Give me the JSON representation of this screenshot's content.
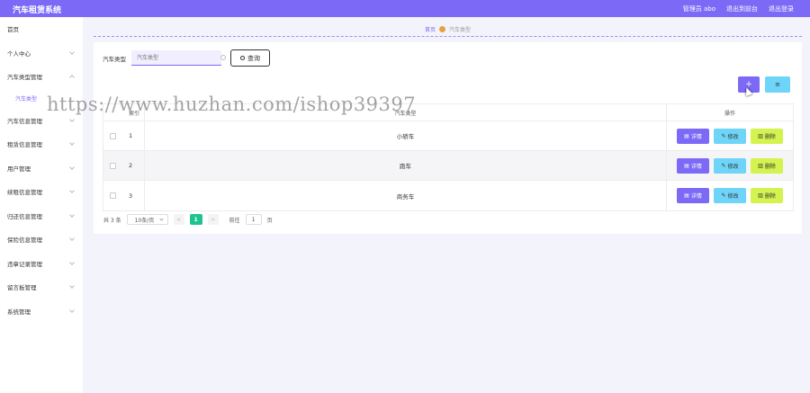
{
  "app": {
    "title": "汽车租赁系统"
  },
  "topbar": {
    "user": "管理员 abo",
    "back_label": "退出到前台",
    "logout_label": "退出登录"
  },
  "sidebar": {
    "items": [
      {
        "label": "首页",
        "has_chevron": false
      },
      {
        "label": "个人中心",
        "has_chevron": true
      },
      {
        "label": "汽车类型管理",
        "has_chevron": true
      },
      {
        "label": "汽车类型",
        "sub": true
      },
      {
        "label": "汽车信息管理",
        "has_chevron": true
      },
      {
        "label": "租赁信息管理",
        "has_chevron": true
      },
      {
        "label": "用户管理",
        "has_chevron": true
      },
      {
        "label": "续租信息管理",
        "has_chevron": true
      },
      {
        "label": "归还信息管理",
        "has_chevron": true
      },
      {
        "label": "保险信息管理",
        "has_chevron": true
      },
      {
        "label": "违章记录管理",
        "has_chevron": true
      },
      {
        "label": "留言板管理",
        "has_chevron": true
      },
      {
        "label": "系统管理",
        "has_chevron": true
      }
    ]
  },
  "breadcrumb": {
    "home": "首页",
    "current": "汽车类型"
  },
  "search": {
    "label": "汽车类型",
    "placeholder": "汽车类型",
    "button_label": "查询"
  },
  "toolbar": {
    "add_label": "+",
    "batch_delete_label": "≡"
  },
  "table": {
    "headers": {
      "index": "索引",
      "name": "汽车类型",
      "ops": "操作"
    },
    "rows": [
      {
        "index": "1",
        "name": "小轿车"
      },
      {
        "index": "2",
        "name": "跑车"
      },
      {
        "index": "3",
        "name": "商务车"
      }
    ],
    "ops": {
      "detail": "详情",
      "edit": "修改",
      "delete": "删除"
    }
  },
  "pagination": {
    "total": "共 3 条",
    "page_size": "10条/页",
    "prev": "<",
    "current": "1",
    "next": ">",
    "goto_label": "前往",
    "goto_value": "1",
    "page_suffix": "页"
  },
  "watermark": "https://www.huzhan.com/ishop39397",
  "colors": {
    "primary": "#7c6af7",
    "cyan": "#6ed4f8",
    "lime": "#d4f34f",
    "green": "#1ec48f"
  }
}
